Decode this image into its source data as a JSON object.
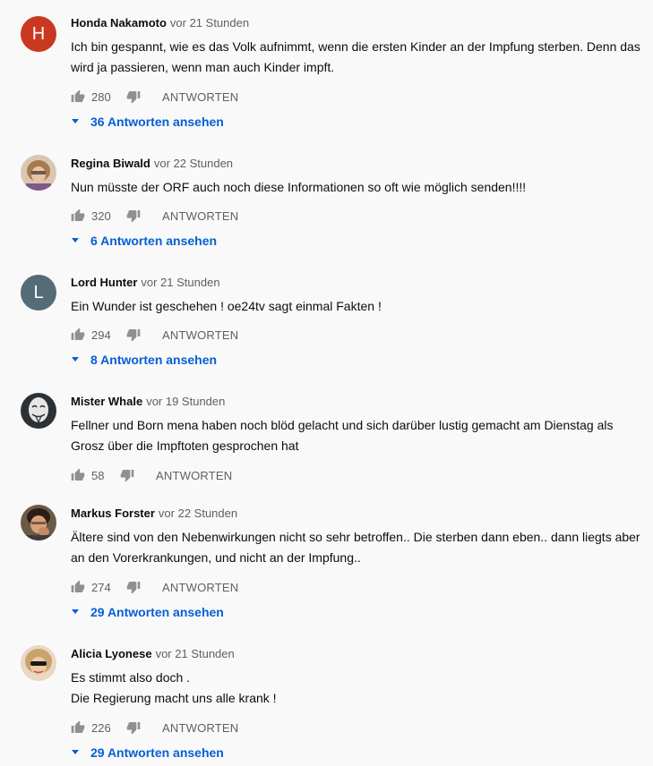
{
  "comments": [
    {
      "author": "Honda Nakamoto",
      "time": "vor 21 Stunden",
      "avatar_letter": "H",
      "avatar_color": "#c9391f",
      "lines": [
        "Ich bin gespannt, wie es das Volk aufnimmt, wenn die ersten Kinder an der Impfung sterben. Denn das",
        "wird ja passieren, wenn man auch Kinder impft."
      ],
      "likes": "280",
      "reply_label": "ANTWORTEN",
      "replies_label": "36 Antworten ansehen"
    },
    {
      "author": "Regina Biwald",
      "time": "vor 22 Stunden",
      "avatar_icon": "photo-avatar-icon",
      "lines": [
        "Nun müsste der ORF auch noch diese Informationen so oft wie möglich senden!!!!"
      ],
      "likes": "320",
      "reply_label": "ANTWORTEN",
      "replies_label": "6 Antworten ansehen"
    },
    {
      "author": "Lord Hunter",
      "time": "vor 21 Stunden",
      "avatar_letter": "L",
      "avatar_color": "#546b78",
      "lines": [
        "Ein Wunder ist geschehen ! oe24tv sagt einmal Fakten !"
      ],
      "likes": "294",
      "reply_label": "ANTWORTEN",
      "replies_label": "8 Antworten ansehen"
    },
    {
      "author": "Mister Whale",
      "time": "vor 19 Stunden",
      "avatar_icon": "mask-avatar-icon",
      "lines": [
        "Fellner und Born mena haben noch blöd gelacht und sich darüber lustig gemacht am Dienstag als",
        "Grosz über die Impftoten gesprochen hat"
      ],
      "likes": "58",
      "reply_label": "ANTWORTEN"
    },
    {
      "author": "Markus Forster",
      "time": "vor 22 Stunden",
      "avatar_icon": "photo-avatar-icon",
      "lines": [
        "Ältere sind von den Nebenwirkungen nicht so sehr betroffen.. Die sterben dann eben.. dann liegts aber",
        "an den Vorerkrankungen, und nicht an der Impfung.."
      ],
      "likes": "274",
      "reply_label": "ANTWORTEN",
      "replies_label": "29 Antworten ansehen"
    },
    {
      "author": "Alicia Lyonese",
      "time": "vor 21 Stunden",
      "avatar_icon": "photo-avatar-icon",
      "lines": [
        "Es stimmt also doch .",
        "Die Regierung  macht uns alle krank !"
      ],
      "likes": "226",
      "reply_label": "ANTWORTEN",
      "replies_label": "29 Antworten ansehen"
    }
  ],
  "colors": {
    "link": "#065fd4",
    "secondary_text": "#606060",
    "background": "#f9f9f9"
  }
}
